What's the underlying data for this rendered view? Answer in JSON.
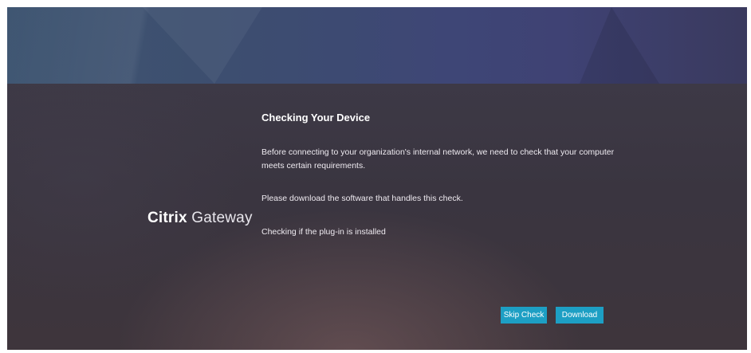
{
  "brand": {
    "bold": "Citrix",
    "light": "Gateway"
  },
  "dialog": {
    "title": "Checking Your Device",
    "paragraph_1": "Before connecting to your organization's internal network, we need to check that your computer meets certain requirements.",
    "paragraph_2": "Please download the software that handles this check.",
    "status": "Checking if the plug-in is installed"
  },
  "buttons": {
    "skip_label": "Skip Check",
    "download_label": "Download"
  },
  "colors": {
    "button": "#1d9fc4",
    "background": "#3a3644"
  }
}
